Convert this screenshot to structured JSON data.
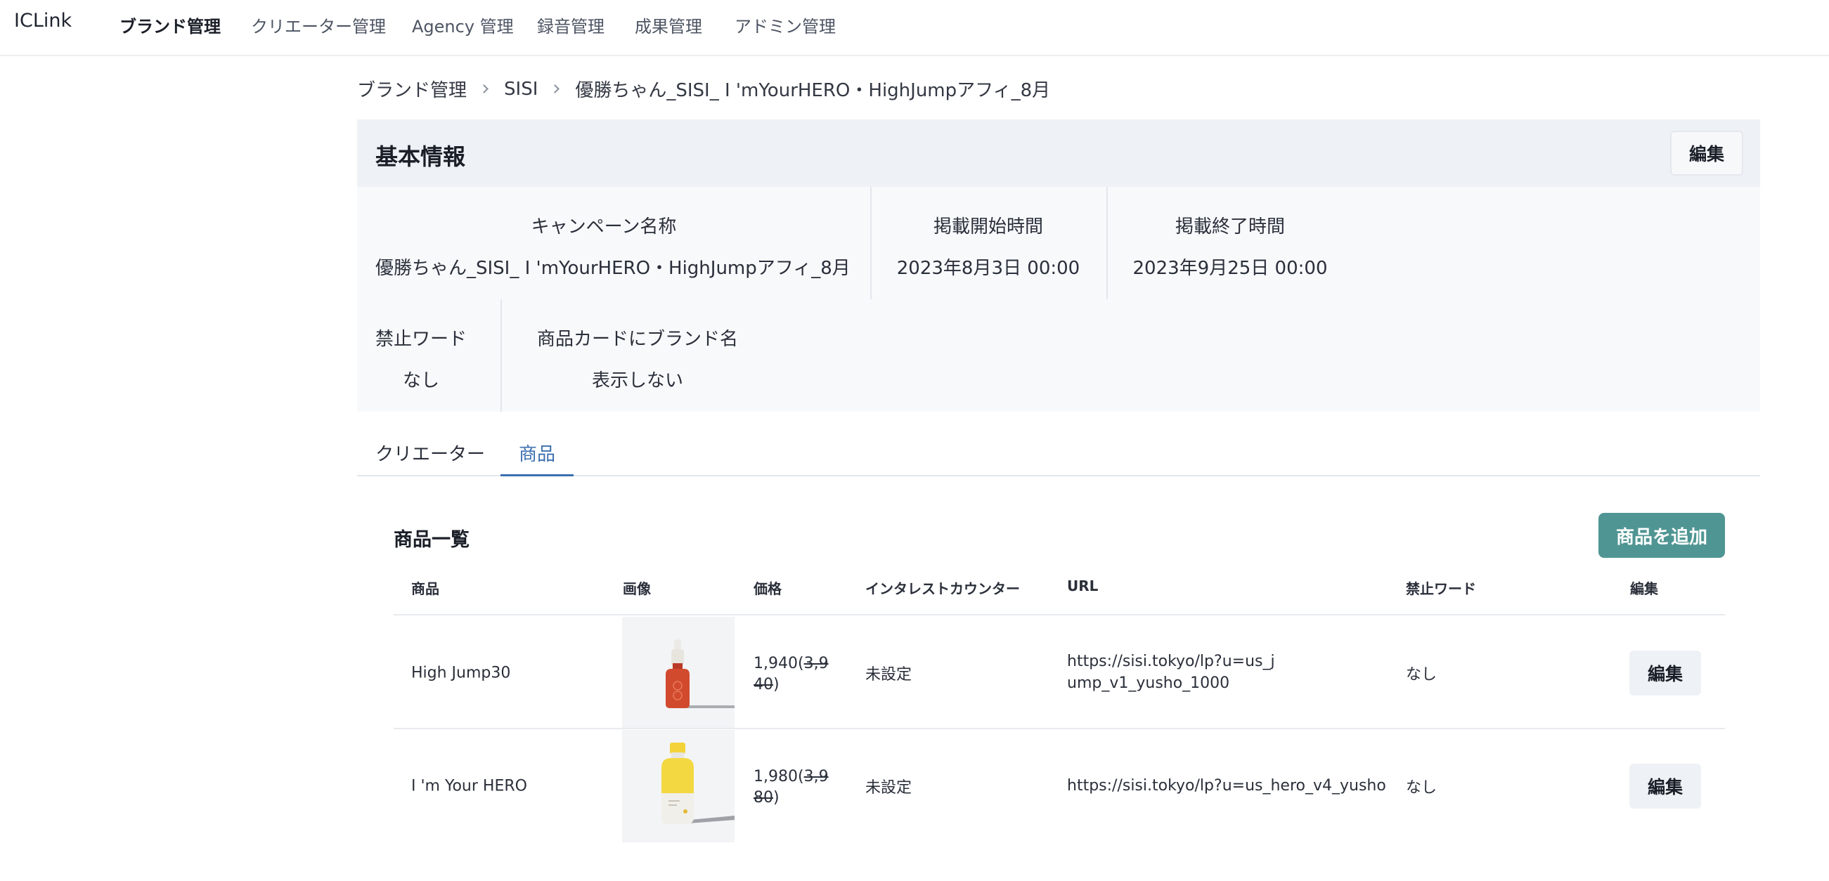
{
  "app": {
    "brand": "ICLink",
    "nav": [
      "ブランド管理",
      "クリエーター管理",
      "Agency 管理",
      "録音管理",
      "成果管理",
      "アドミン管理"
    ],
    "active_nav": "ブランド管理"
  },
  "breadcrumb": [
    "ブランド管理",
    "SISI",
    "優勝ちゃん_SISI_ I 'mYourHERO・HighJumpアフィ_8月"
  ],
  "basic_info": {
    "title": "基本情報",
    "edit_label": "編集",
    "fields": {
      "campaign_name": {
        "label": "キャンペーン名称",
        "value": "優勝ちゃん_SISI_ I 'mYourHERO・HighJumpアフィ_8月"
      },
      "start_time": {
        "label": "掲載開始時間",
        "value": "2023年8月3日 00:00"
      },
      "end_time": {
        "label": "掲載終了時間",
        "value": "2023年9月25日 00:00"
      },
      "banned_words": {
        "label": "禁止ワード",
        "value": "なし"
      },
      "brand_on_card": {
        "label": "商品カードにブランド名",
        "value": "表示しない"
      }
    }
  },
  "tabs": [
    "クリエーター",
    "商品"
  ],
  "active_tab": "商品",
  "products": {
    "title": "商品一覧",
    "add_label": "商品を追加",
    "columns": [
      "商品",
      "画像",
      "価格",
      "インタレストカウンター",
      "URL",
      "禁止ワード",
      "編集"
    ],
    "rows": [
      {
        "name": "High Jump30",
        "image_icon": "red-dropper-bottle-image",
        "price": "1,940",
        "original_price": "3,940",
        "interest_counter": "未設定",
        "url": "https://sisi.tokyo/lp?u=us_jump_v1_yusho_1000",
        "banned_words": "なし",
        "edit_label": "編集"
      },
      {
        "name": "I 'm Your HERO",
        "image_icon": "yellow-bottle-image",
        "price": "1,980",
        "original_price": "3,980",
        "interest_counter": "未設定",
        "url": "https://sisi.tokyo/lp?u=us_hero_v4_yusho",
        "banned_words": "なし",
        "edit_label": "編集"
      }
    ]
  },
  "colors": {
    "accent_button": "#4f9593",
    "active_tab": "#3c6fb0",
    "card_header_bg": "#eef1f5"
  }
}
